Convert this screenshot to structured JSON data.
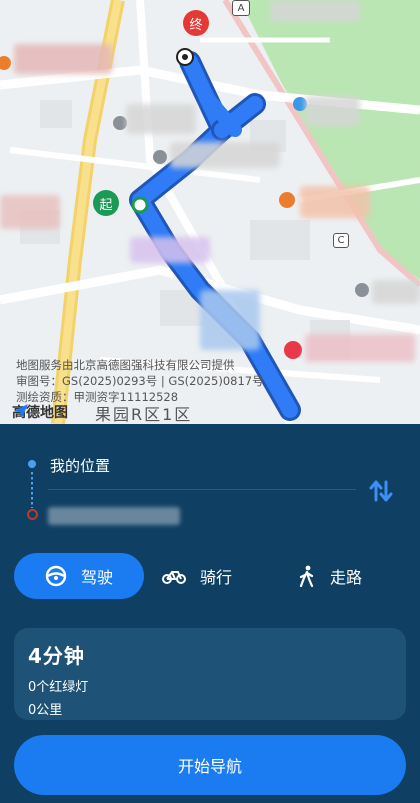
{
  "map": {
    "attribution": [
      "地图服务由北京高德图强科技有限公司提供",
      "审图号：GS(2025)0293号 | GS(2025)0817号",
      "测绘资质：甲测资字11112528"
    ],
    "logo_text": "高德地图",
    "district_label": "果园R区1区",
    "start_marker": "起",
    "end_marker": "终",
    "poi_letters": [
      "A",
      "C"
    ]
  },
  "route": {
    "from_label": "我的位置",
    "swap_icon": "swap-icon"
  },
  "modes": [
    {
      "label": "驾驶",
      "icon": "steering-wheel-icon",
      "active": true
    },
    {
      "label": "骑行",
      "icon": "bicycle-icon",
      "active": false
    },
    {
      "label": "走路",
      "icon": "walking-icon",
      "active": false
    }
  ],
  "summary": {
    "time": "4分钟",
    "traffic_lights": "0个红绿灯",
    "distance": "0公里"
  },
  "start_button": {
    "label": "开始导航"
  },
  "colors": {
    "panel_bg": "#0f3f63",
    "accent": "#1a7cf0",
    "route": "#2f7cf6",
    "card_bg": "#1e5377"
  }
}
